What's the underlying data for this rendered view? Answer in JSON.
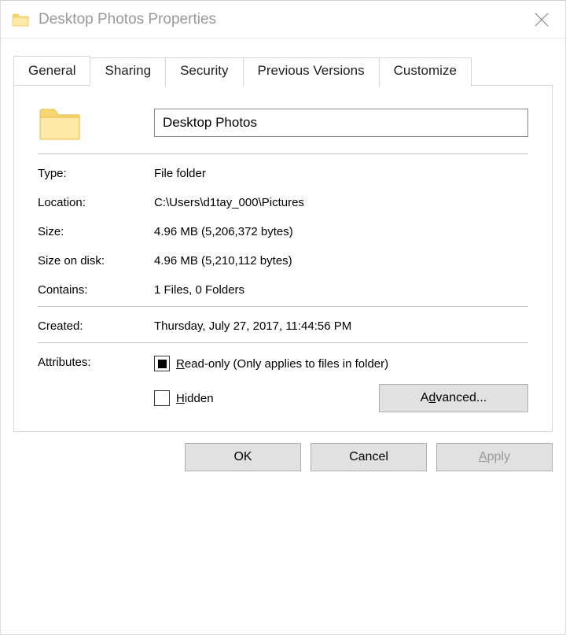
{
  "window": {
    "title": "Desktop Photos Properties"
  },
  "tabs": [
    "General",
    "Sharing",
    "Security",
    "Previous Versions",
    "Customize"
  ],
  "active_tab": 0,
  "general": {
    "name_value": "Desktop Photos",
    "type_label": "Type:",
    "type_value": "File folder",
    "location_label": "Location:",
    "location_value": "C:\\Users\\d1tay_000\\Pictures",
    "size_label": "Size:",
    "size_value": "4.96 MB (5,206,372 bytes)",
    "sizeondisk_label": "Size on disk:",
    "sizeondisk_value": "4.96 MB (5,210,112 bytes)",
    "contains_label": "Contains:",
    "contains_value": "1 Files, 0 Folders",
    "created_label": "Created:",
    "created_value": "Thursday, July 27, 2017, 11:44:56 PM",
    "attributes_label": "Attributes:",
    "readonly_text": "ead-only (Only applies to files in folder)",
    "readonly_access": "R",
    "hidden_text": "idden",
    "hidden_access": "H",
    "advanced_pre": "A",
    "advanced_access": "d",
    "advanced_post": "vanced..."
  },
  "buttons": {
    "ok": "OK",
    "cancel": "Cancel",
    "apply_access": "A",
    "apply_post": "pply"
  }
}
